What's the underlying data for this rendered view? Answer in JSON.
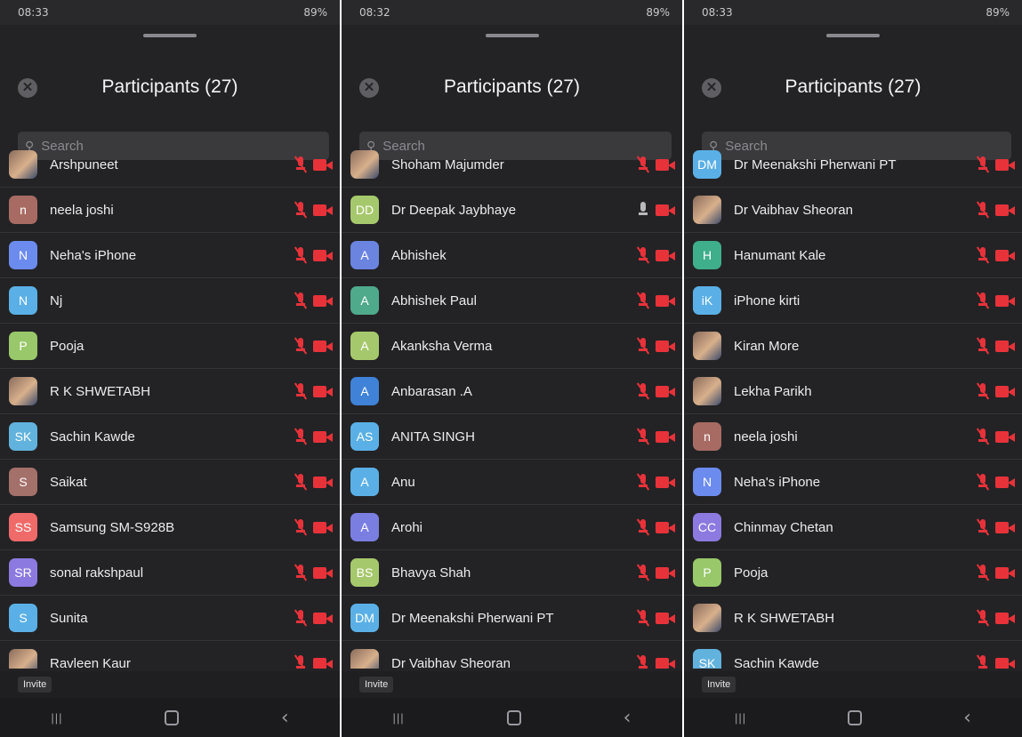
{
  "icons": {
    "close": "close-circle-icon",
    "search": "search-icon",
    "mic": "mic-muted-icon",
    "video": "video-off-icon"
  },
  "colors": {
    "muted": "#e8323a",
    "background": "#232325"
  },
  "screens": [
    {
      "status": {
        "time": "08:33",
        "battery": "89%"
      },
      "title": "Participants (27)",
      "search_placeholder": "Search",
      "invite_label": "Invite",
      "participants": [
        {
          "name": "Arshpuneet",
          "initials": "",
          "avatar_color": "",
          "mic": "muted",
          "video": "off"
        },
        {
          "name": "neela joshi",
          "initials": "n",
          "avatar_color": "#a86b63",
          "mic": "muted",
          "video": "off"
        },
        {
          "name": "Neha's iPhone",
          "initials": "N",
          "avatar_color": "#6c8bee",
          "mic": "muted",
          "video": "off"
        },
        {
          "name": "Nj",
          "initials": "N",
          "avatar_color": "#5ab0e6",
          "mic": "muted",
          "video": "off"
        },
        {
          "name": "Pooja",
          "initials": "P",
          "avatar_color": "#98c86a",
          "mic": "muted",
          "video": "off"
        },
        {
          "name": "R K SHWETABH",
          "initials": "",
          "avatar_color": "",
          "mic": "muted",
          "video": "off"
        },
        {
          "name": "Sachin Kawde",
          "initials": "SK",
          "avatar_color": "#62b2de",
          "mic": "muted",
          "video": "off"
        },
        {
          "name": "Saikat",
          "initials": "S",
          "avatar_color": "#a4706a",
          "mic": "muted",
          "video": "off"
        },
        {
          "name": "Samsung SM-S928B",
          "initials": "SS",
          "avatar_color": "#f06a6a",
          "mic": "muted",
          "video": "off"
        },
        {
          "name": "sonal rakshpaul",
          "initials": "SR",
          "avatar_color": "#8c7ae0",
          "mic": "muted",
          "video": "off"
        },
        {
          "name": "Sunita",
          "initials": "S",
          "avatar_color": "#5ab0e6",
          "mic": "muted",
          "video": "off"
        },
        {
          "name": "Ravleen Kaur",
          "initials": "",
          "avatar_color": "",
          "mic": "muted",
          "video": "off"
        }
      ]
    },
    {
      "status": {
        "time": "08:32",
        "battery": "89%"
      },
      "title": "Participants (27)",
      "search_placeholder": "Search",
      "invite_label": "Invite",
      "participants": [
        {
          "name": "Shoham Majumder",
          "initials": "",
          "avatar_color": "",
          "mic": "muted",
          "video": "off"
        },
        {
          "name": "Dr Deepak Jaybhaye",
          "initials": "DD",
          "avatar_color": "#a6c86c",
          "mic": "on",
          "video": "off"
        },
        {
          "name": "Abhishek",
          "initials": "A",
          "avatar_color": "#6a84e0",
          "mic": "muted",
          "video": "off"
        },
        {
          "name": "Abhishek Paul",
          "initials": "A",
          "avatar_color": "#4faa8c",
          "mic": "muted",
          "video": "off"
        },
        {
          "name": "Akanksha  Verma",
          "initials": "A",
          "avatar_color": "#a6c86c",
          "mic": "muted",
          "video": "off"
        },
        {
          "name": "Anbarasan .A",
          "initials": "A",
          "avatar_color": "#3f82d8",
          "mic": "muted",
          "video": "off"
        },
        {
          "name": "ANITA SINGH",
          "initials": "AS",
          "avatar_color": "#5ab0e6",
          "mic": "muted",
          "video": "off"
        },
        {
          "name": "Anu",
          "initials": "A",
          "avatar_color": "#5ab0e6",
          "mic": "muted",
          "video": "off"
        },
        {
          "name": "Arohi",
          "initials": "A",
          "avatar_color": "#7a7ee0",
          "mic": "muted",
          "video": "off"
        },
        {
          "name": "Bhavya Shah",
          "initials": "BS",
          "avatar_color": "#a6c86c",
          "mic": "muted",
          "video": "off"
        },
        {
          "name": "Dr Meenakshi Pherwani PT",
          "initials": "DM",
          "avatar_color": "#5ab0e6",
          "mic": "muted",
          "video": "off"
        },
        {
          "name": "Dr Vaibhav Sheoran",
          "initials": "",
          "avatar_color": "",
          "mic": "muted",
          "video": "off"
        }
      ]
    },
    {
      "status": {
        "time": "08:33",
        "battery": "89%"
      },
      "title": "Participants (27)",
      "search_placeholder": "Search",
      "invite_label": "Invite",
      "participants": [
        {
          "name": "Dr Meenakshi Pherwani PT",
          "initials": "DM",
          "avatar_color": "#5ab0e6",
          "mic": "muted",
          "video": "off"
        },
        {
          "name": "Dr Vaibhav Sheoran",
          "initials": "",
          "avatar_color": "",
          "mic": "muted",
          "video": "off"
        },
        {
          "name": "Hanumant Kale",
          "initials": "H",
          "avatar_color": "#3fae8a",
          "mic": "muted",
          "video": "off"
        },
        {
          "name": "iPhone kirti",
          "initials": "iK",
          "avatar_color": "#5ab0e6",
          "mic": "muted",
          "video": "off"
        },
        {
          "name": "Kiran More",
          "initials": "",
          "avatar_color": "",
          "mic": "muted",
          "video": "off"
        },
        {
          "name": "Lekha Parikh",
          "initials": "",
          "avatar_color": "",
          "mic": "muted",
          "video": "off"
        },
        {
          "name": "neela joshi",
          "initials": "n",
          "avatar_color": "#a86b63",
          "mic": "muted",
          "video": "off"
        },
        {
          "name": "Neha's iPhone",
          "initials": "N",
          "avatar_color": "#6c8bee",
          "mic": "muted",
          "video": "off"
        },
        {
          "name": "Chinmay Chetan",
          "initials": "CC",
          "avatar_color": "#8c7ae0",
          "mic": "muted",
          "video": "off"
        },
        {
          "name": "Pooja",
          "initials": "P",
          "avatar_color": "#98c86a",
          "mic": "muted",
          "video": "off"
        },
        {
          "name": "R K SHWETABH",
          "initials": "",
          "avatar_color": "",
          "mic": "muted",
          "video": "off"
        },
        {
          "name": "Sachin Kawde",
          "initials": "SK",
          "avatar_color": "#62b2de",
          "mic": "muted",
          "video": "off"
        }
      ]
    }
  ]
}
